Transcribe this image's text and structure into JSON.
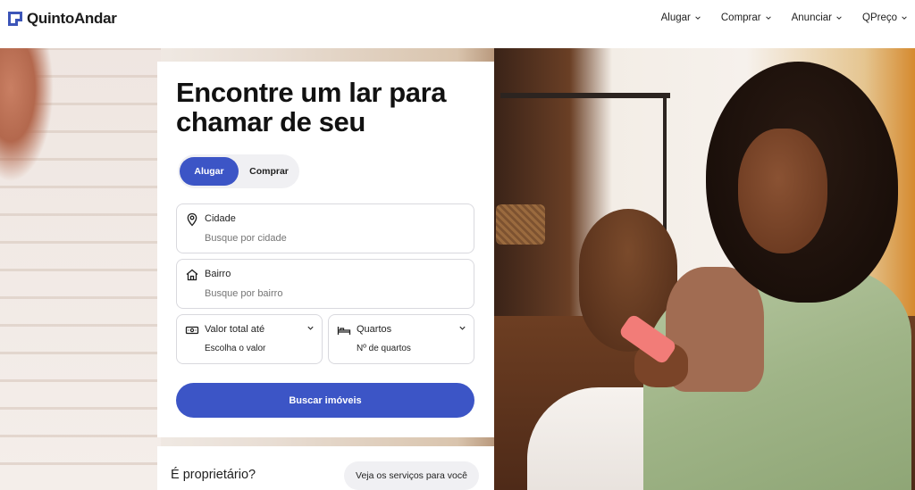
{
  "brand": {
    "name": "QuintoAndar",
    "color": "#3c55b8"
  },
  "nav": {
    "items": [
      {
        "label": "Alugar"
      },
      {
        "label": "Comprar"
      },
      {
        "label": "Anunciar"
      },
      {
        "label": "QPreço"
      }
    ]
  },
  "hero": {
    "headline": "Encontre um lar para chamar de seu"
  },
  "search": {
    "toggle": {
      "options": [
        "Alugar",
        "Comprar"
      ],
      "selected": "Alugar"
    },
    "city": {
      "label": "Cidade",
      "placeholder": "Busque por cidade",
      "icon": "location-pin-icon"
    },
    "bairro": {
      "label": "Bairro",
      "placeholder": "Busque por bairro",
      "icon": "house-icon"
    },
    "valor": {
      "label": "Valor total até",
      "value": "Escolha o valor",
      "icon": "money-icon"
    },
    "quartos": {
      "label": "Quartos",
      "value": "Nº de quartos",
      "icon": "bed-icon"
    },
    "submit_label": "Buscar imóveis",
    "accent": "#3c55c6"
  },
  "owner": {
    "text": "É proprietário?",
    "button_label": "Veja os serviços para você"
  }
}
